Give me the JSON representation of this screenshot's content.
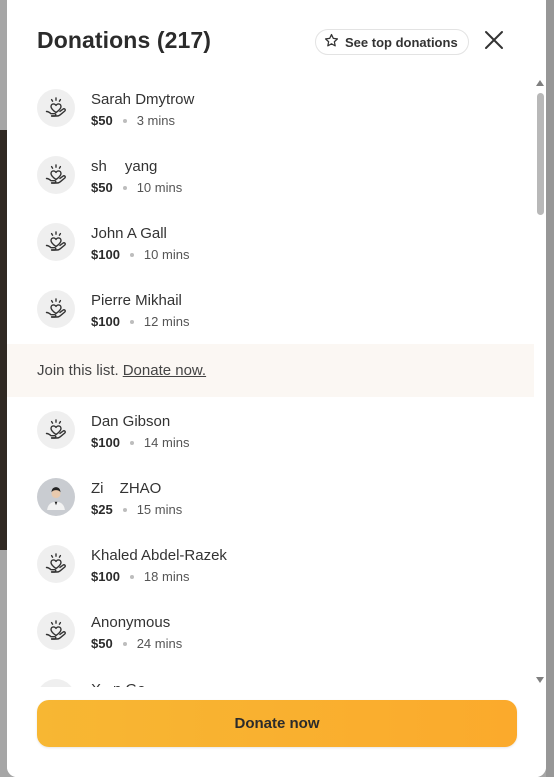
{
  "header": {
    "title": "Donations (217)",
    "top_donations_label": "See top donations"
  },
  "donations": [
    {
      "name": "Sarah Dmytrow",
      "amount": "$50",
      "time": "3 mins",
      "avatar": "heart-hand-icon"
    },
    {
      "name": "sh      yang",
      "amount": "$50",
      "time": "10 mins",
      "avatar": "heart-hand-icon"
    },
    {
      "name": "John A Gall",
      "amount": "$100",
      "time": "10 mins",
      "avatar": "heart-hand-icon"
    },
    {
      "name": "Pierre Mikhail",
      "amount": "$100",
      "time": "12 mins",
      "avatar": "heart-hand-icon"
    },
    {
      "name": "Dan Gibson",
      "amount": "$100",
      "time": "14 mins",
      "avatar": "heart-hand-icon"
    },
    {
      "name": "Zi     ZHAO",
      "amount": "$25",
      "time": "15 mins",
      "avatar": "user-photo"
    },
    {
      "name": "Khaled Abdel-Razek",
      "amount": "$100",
      "time": "18 mins",
      "avatar": "heart-hand-icon"
    },
    {
      "name": "Anonymous",
      "amount": "$50",
      "time": "24 mins",
      "avatar": "heart-hand-icon"
    },
    {
      "name": "X    n Ge",
      "amount": "",
      "time": "",
      "avatar": "heart-hand-icon"
    }
  ],
  "join": {
    "text": "Join this list.",
    "link": "Donate now."
  },
  "footer": {
    "donate_label": "Donate now"
  },
  "colors": {
    "accent": "#f9b233",
    "join_bg": "#fbf7f3"
  }
}
